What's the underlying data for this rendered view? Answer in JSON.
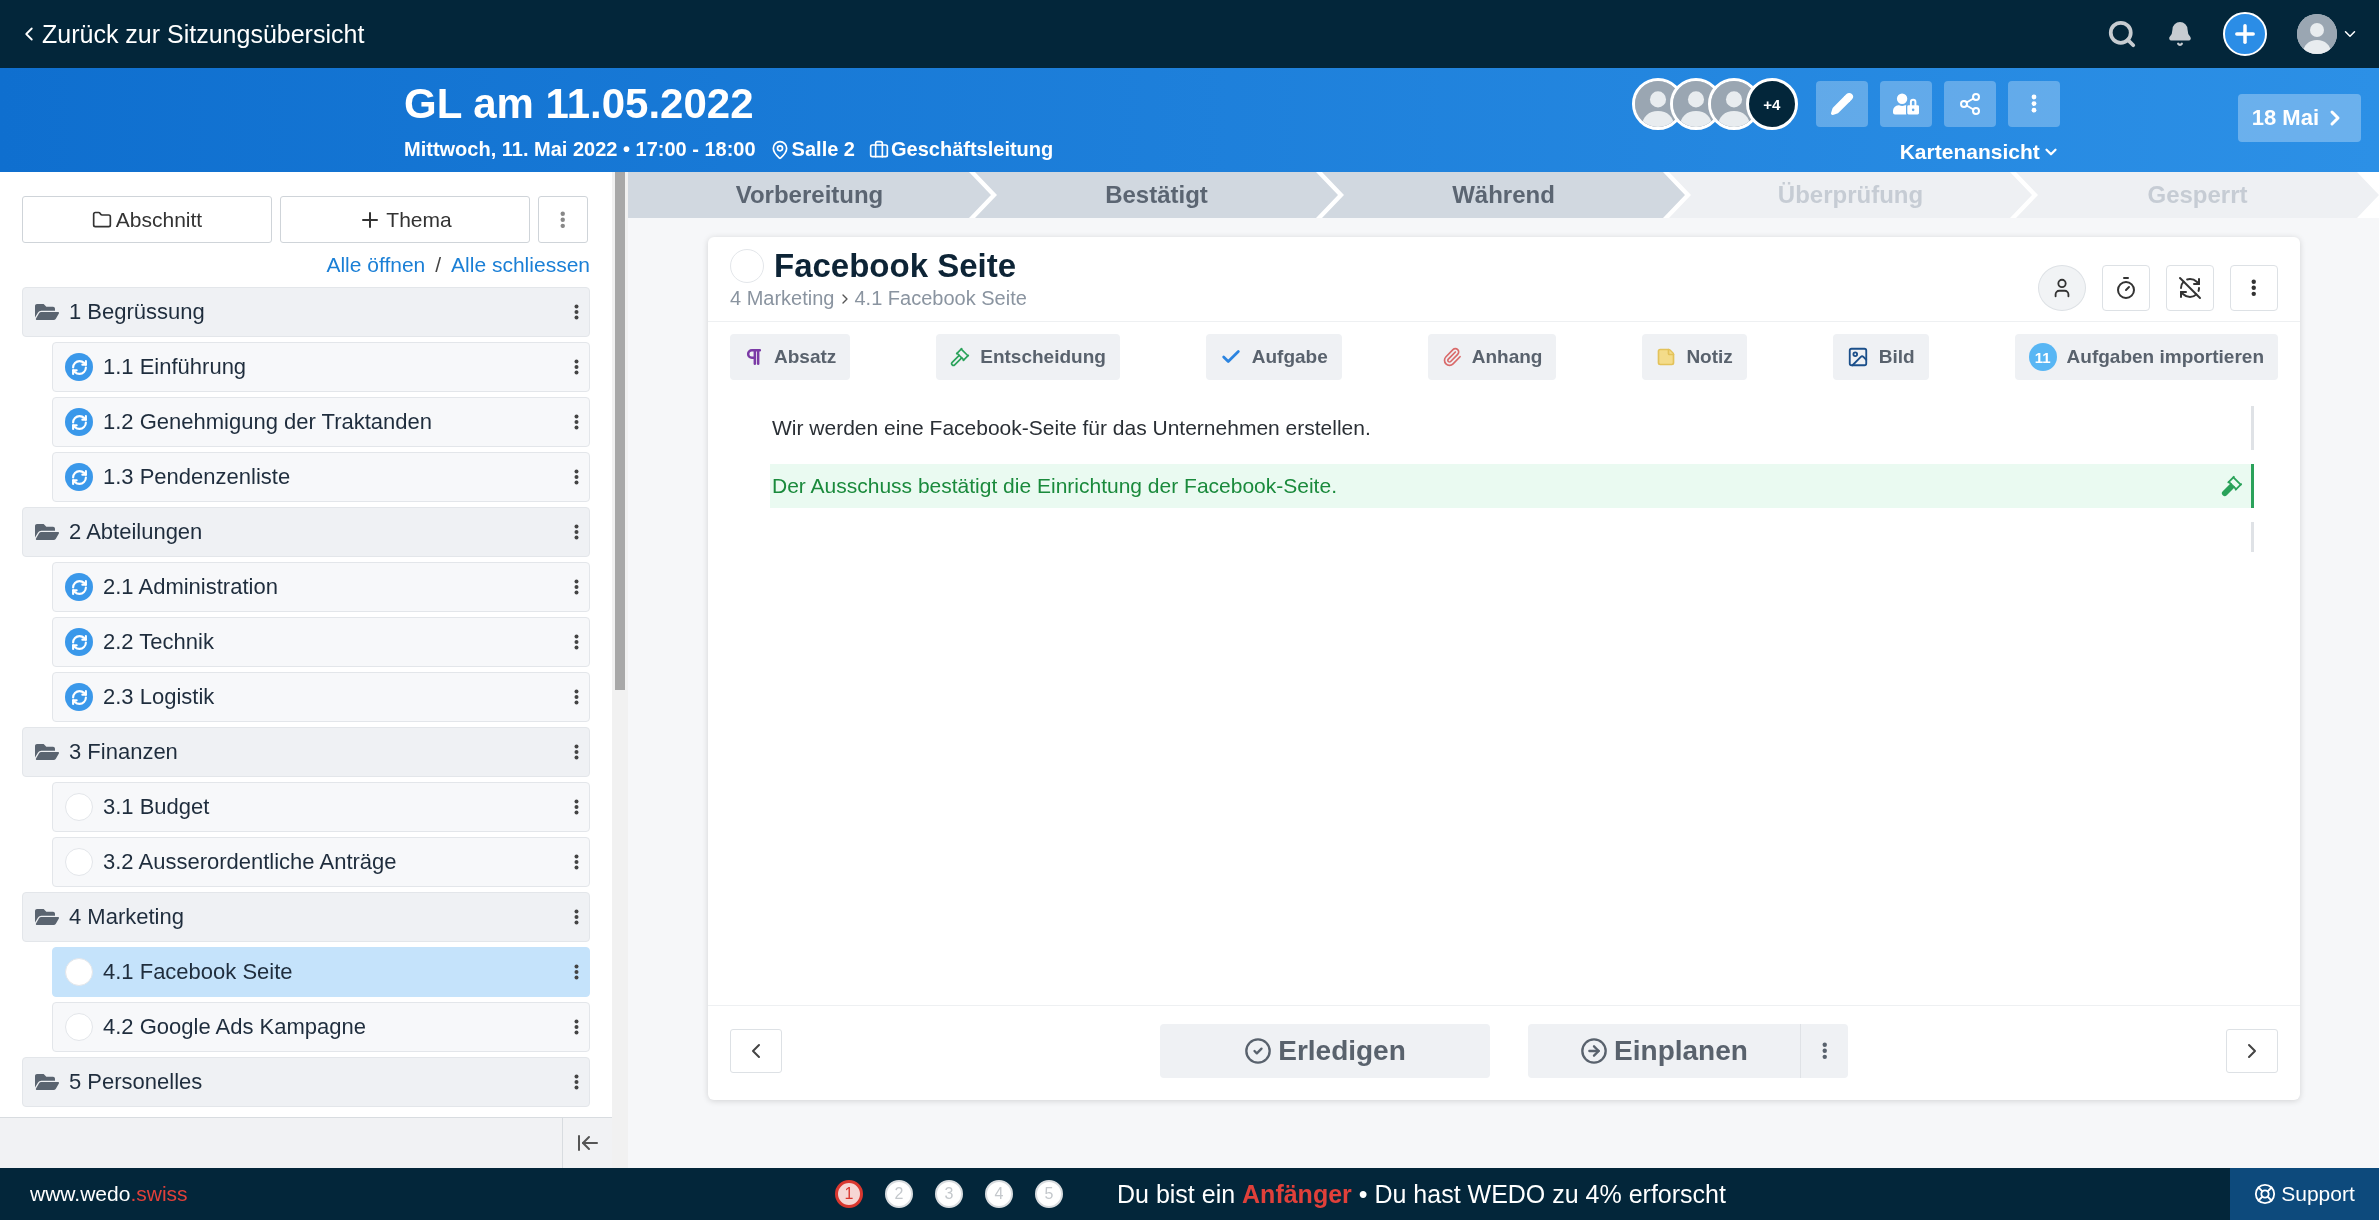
{
  "top_bar": {
    "back_link": "Zurück zur Sitzungsübersicht"
  },
  "meeting": {
    "title": "GL am 11.05.2022",
    "date_time": "Mittwoch, 11. Mai 2022 • 17:00 - 18:00",
    "location": "Salle 2",
    "group": "Geschäftsleitung",
    "participants_more": "+4",
    "view_selector": "Kartenansicht",
    "next_meeting": "18 Mai"
  },
  "sidebar": {
    "buttons": [
      "Abschnitt",
      "Thema"
    ],
    "expand_all": "Alle öffnen",
    "separator": "/",
    "collapse_all": "Alle schliessen",
    "sections": [
      {
        "label": "1 Begrüssung",
        "topics": [
          {
            "label": "1.1 Einführung",
            "recurring": true,
            "selected": false
          },
          {
            "label": "1.2 Genehmigung der Traktanden",
            "recurring": true,
            "selected": false
          },
          {
            "label": "1.3 Pendenzenliste",
            "recurring": true,
            "selected": false
          }
        ]
      },
      {
        "label": "2 Abteilungen",
        "topics": [
          {
            "label": "2.1 Administration",
            "recurring": true,
            "selected": false
          },
          {
            "label": "2.2 Technik",
            "recurring": true,
            "selected": false
          },
          {
            "label": "2.3 Logistik",
            "recurring": true,
            "selected": false
          }
        ]
      },
      {
        "label": "3 Finanzen",
        "topics": [
          {
            "label": "3.1 Budget",
            "recurring": false,
            "selected": false
          },
          {
            "label": "3.2 Ausserordentliche Anträge",
            "recurring": false,
            "selected": false
          }
        ]
      },
      {
        "label": "4 Marketing",
        "topics": [
          {
            "label": "4.1 Facebook Seite",
            "recurring": false,
            "selected": true
          },
          {
            "label": "4.2 Google Ads Kampagne",
            "recurring": false,
            "selected": false
          }
        ]
      },
      {
        "label": "5 Personelles"
      }
    ]
  },
  "stages": [
    {
      "label": "Vorbereitung",
      "reached": true
    },
    {
      "label": "Bestätigt",
      "reached": true
    },
    {
      "label": "Während",
      "reached": true
    },
    {
      "label": "Überprüfung",
      "reached": false
    },
    {
      "label": "Gesperrt",
      "reached": false
    }
  ],
  "topic": {
    "title": "Facebook Seite",
    "breadcrumb": [
      "4 Marketing",
      "4.1 Facebook Seite"
    ],
    "insert_buttons": [
      {
        "kind": "paragraph",
        "label": "Absatz"
      },
      {
        "kind": "decision",
        "label": "Entscheidung"
      },
      {
        "kind": "task",
        "label": "Aufgabe"
      },
      {
        "kind": "attachment",
        "label": "Anhang"
      },
      {
        "kind": "note",
        "label": "Notiz"
      },
      {
        "kind": "image",
        "label": "Bild"
      },
      {
        "kind": "import",
        "label": "Aufgaben importieren",
        "count": "11"
      }
    ],
    "blocks": [
      {
        "kind": "paragraph",
        "text": "Wir werden eine Facebook-Seite für das Unternehmen erstellen."
      },
      {
        "kind": "decision",
        "text": "Der Ausschuss bestätigt die Einrichtung der Facebook-Seite."
      },
      {
        "kind": "empty"
      }
    ],
    "actions": {
      "complete": "Erledigen",
      "schedule": "Einplanen"
    }
  },
  "footer": {
    "site": "www.wedo",
    "site_accent": ".swiss",
    "steps": [
      {
        "label": "1",
        "selected": true
      },
      {
        "label": "2",
        "selected": false
      },
      {
        "label": "3",
        "selected": false
      },
      {
        "label": "4",
        "selected": false
      },
      {
        "label": "5",
        "selected": false
      }
    ],
    "progress": "Du bist ein **Anfänger** • Du hast WEDO zu 4% erforscht",
    "support": "Support"
  }
}
